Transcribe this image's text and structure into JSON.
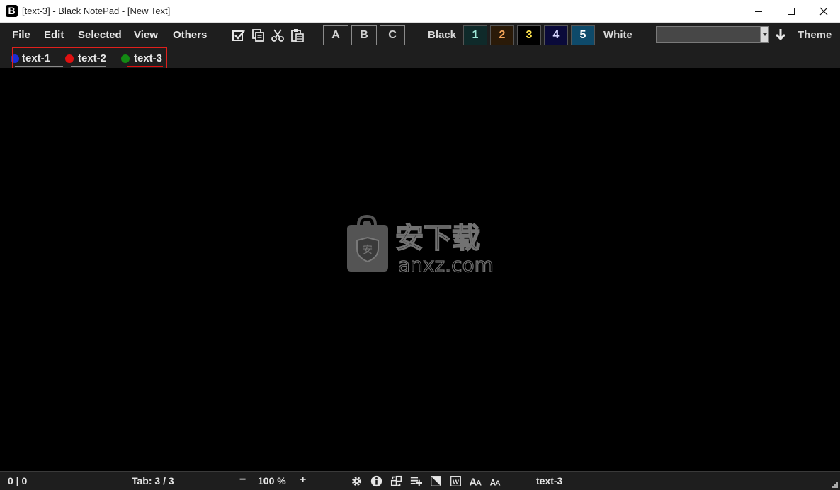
{
  "window": {
    "app_icon_letter": "B",
    "title": "[text-3] - Black NotePad - [New Text]"
  },
  "menu": [
    "File",
    "Edit",
    "Selected",
    "View",
    "Others"
  ],
  "toolbar": {
    "icons": [
      "check-square-icon",
      "copy-icon",
      "cut-icon",
      "paste-icon"
    ],
    "abc": [
      "A",
      "B",
      "C"
    ],
    "black_label": "Black",
    "white_label": "White",
    "numbers": [
      {
        "label": "1",
        "color": "#9fe8d8",
        "bg": "#0f2a2a"
      },
      {
        "label": "2",
        "color": "#f5a65b",
        "bg": "#2a1a08"
      },
      {
        "label": "3",
        "color": "#ffe44d",
        "bg": "#000000"
      },
      {
        "label": "4",
        "color": "#d6d6ff",
        "bg": "#0a0a3a"
      },
      {
        "label": "5",
        "color": "#ffffff",
        "bg": "#0e4a6a"
      }
    ],
    "theme_select_value": "",
    "theme_label": "Theme"
  },
  "tabs": [
    {
      "label": "text-1",
      "dot_color": "#1d2bd6",
      "underline": "#8a8a8a"
    },
    {
      "label": "text-2",
      "dot_color": "#e01010",
      "underline": "#8a8a8a"
    },
    {
      "label": "text-3",
      "dot_color": "#138a13",
      "underline": "#e01010",
      "active": true
    }
  ],
  "watermark": {
    "cn_text": "安下载",
    "domain_text": "anxz.com"
  },
  "status": {
    "cursor_pos": "0 | 0",
    "tab_info": "Tab: 3 / 3",
    "zoom_minus": "−",
    "zoom": "100 %",
    "zoom_plus": "+",
    "icons": [
      "gear-icon",
      "info-icon",
      "swap-icon",
      "list-add-icon",
      "contrast-icon",
      "word-wrap-icon",
      "font-increase-icon",
      "font-decrease-icon"
    ],
    "current_tab": "text-3"
  }
}
